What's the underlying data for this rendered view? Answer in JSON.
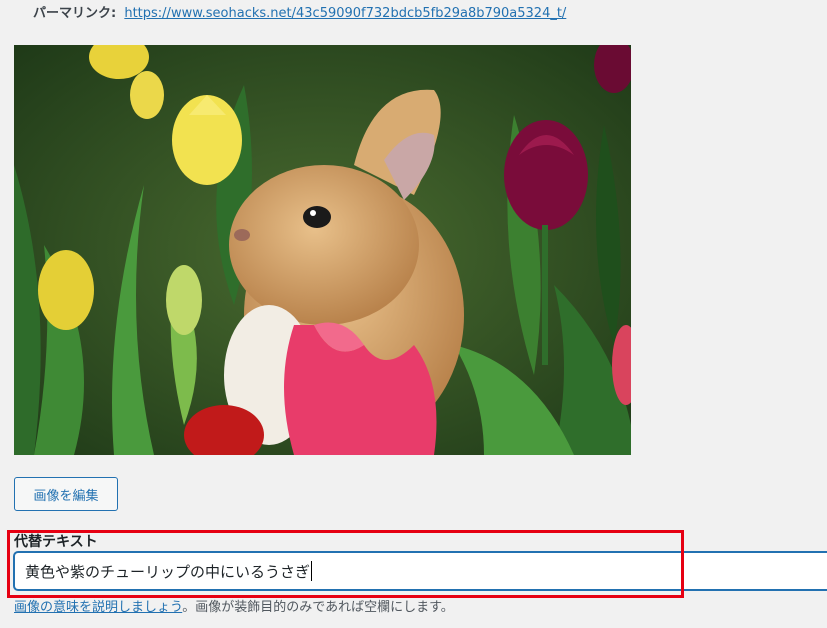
{
  "permalink": {
    "label": "パーマリンク:",
    "url": "https://www.seohacks.net/43c59090f732bdcb5fb29a8b790a5324_t/"
  },
  "image": {
    "description_icon": "photo-rabbit-tulips"
  },
  "buttons": {
    "edit_image": "画像を編集"
  },
  "alt_text": {
    "label": "代替テキスト",
    "value": "黄色や紫のチューリップの中にいるうさぎ"
  },
  "help": {
    "link_text": "画像の意味を説明しましょう",
    "rest_text": "。画像が装飾目的のみであれば空欄にします。"
  },
  "colors": {
    "accent": "#2271b1",
    "highlight": "#e60012"
  }
}
